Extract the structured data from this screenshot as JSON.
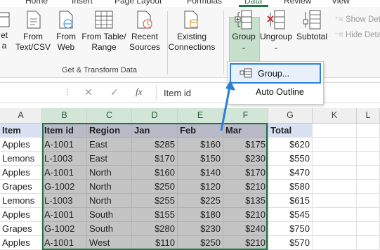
{
  "tabs": [
    "Home",
    "Insert",
    "Page Layout",
    "Formulas",
    "Data",
    "Review",
    "View"
  ],
  "active_tab": "Data",
  "ribbon": {
    "get_data_partial": {
      "line1": "et",
      "line2": "a"
    },
    "from_text_csv": {
      "line1": "From",
      "line2": "Text/CSV"
    },
    "from_web": {
      "line1": "From",
      "line2": "Web"
    },
    "from_table_range": {
      "line1": "From Table/",
      "line2": "Range"
    },
    "recent_sources": {
      "line1": "Recent",
      "line2": "Sources"
    },
    "existing_connections": {
      "line1": "Existing",
      "line2": "Connections"
    },
    "get_transform_caption": "Get & Transform Data",
    "group": {
      "label": "Group"
    },
    "ungroup": {
      "label": "Ungroup"
    },
    "subtotal": {
      "label": "Subtotal"
    },
    "show_detail": "Show Det",
    "hide_detail": "Hide Deta"
  },
  "dropdown": {
    "group_item": "Group...",
    "auto_outline": "Auto Outline"
  },
  "formula_bar": {
    "fx": "fx",
    "content": "Item id"
  },
  "colors": {
    "accent": "#217346",
    "header_fill": "#d9e1f2",
    "selection_fill": "#c4c4c4",
    "arrow": "#2d7fd8"
  },
  "columns": [
    "A",
    "B",
    "C",
    "D",
    "E",
    "F",
    "G",
    "K",
    "L"
  ],
  "table": {
    "headers": [
      "Item",
      "Item id",
      "Region",
      "Jan",
      "Feb",
      "Mar",
      "Total"
    ],
    "rows": [
      [
        "Apples",
        "A-1001",
        "East",
        "$285",
        "$160",
        "$175",
        "$620"
      ],
      [
        "Lemons",
        "L-1003",
        "East",
        "$170",
        "$150",
        "$230",
        "$550"
      ],
      [
        "Apples",
        "A-1001",
        "North",
        "$160",
        "$140",
        "$170",
        "$470"
      ],
      [
        "Grapes",
        "G-1002",
        "North",
        "$250",
        "$120",
        "$210",
        "$580"
      ],
      [
        "Lemons",
        "L-1003",
        "North",
        "$255",
        "$225",
        "$135",
        "$615"
      ],
      [
        "Apples",
        "A-1001",
        "South",
        "$155",
        "$180",
        "$210",
        "$545"
      ],
      [
        "Grapes",
        "G-1002",
        "South",
        "$280",
        "$230",
        "$240",
        "$750"
      ],
      [
        "Apples",
        "A-1001",
        "West",
        "$110",
        "$250",
        "$210",
        "$570"
      ]
    ]
  }
}
